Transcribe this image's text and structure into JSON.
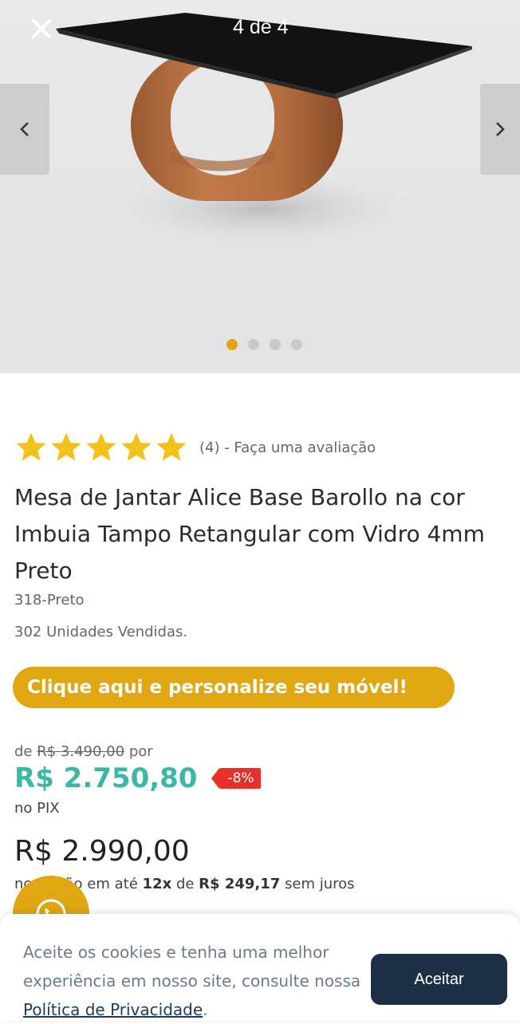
{
  "gallery": {
    "counter": "4 de 4",
    "total_images": 4,
    "active_index": 4,
    "accent_color": "#e0a712"
  },
  "icons": {
    "close": "close-icon",
    "prev": "chevron-left-icon",
    "next": "chevron-right-icon",
    "star": "star-icon",
    "whatsapp": "whatsapp-icon"
  },
  "product": {
    "rating": 5,
    "max_rating": 5,
    "rating_text": "(4) - Faça uma avaliação",
    "title": "Mesa de Jantar Alice Base Barollo na cor Imbuia Tampo Retangular com Vidro 4mm Preto",
    "sku": "318-Preto",
    "sold": "302 Unidades Vendidas."
  },
  "customize_button": "Clique aqui e personalize seu móvel!",
  "pricing": {
    "old_prefix": "de",
    "old_price": "R$ 3.490,00",
    "old_suffix": "por",
    "pix_price": "R$ 2.750,80",
    "discount": "-8%",
    "pix_label": "no PIX",
    "card_price": "R$ 2.990,00",
    "installments_prefix": "no cartão em até",
    "installments_count": "12x",
    "installments_mid": "de",
    "installments_value": "R$ 249,17",
    "installments_suffix": "sem juros"
  },
  "cookie": {
    "text": "Aceite os cookies e tenha uma melhor experiência em nosso site, consulte nossa",
    "link_text": "Política de Privacidade",
    "link_suffix": ".",
    "accept_label": "Aceitar"
  },
  "colors": {
    "accent": "#e0a712",
    "pix_price": "#3bb7a8",
    "discount": "#e8302a",
    "accept_button": "#1d2f44"
  }
}
